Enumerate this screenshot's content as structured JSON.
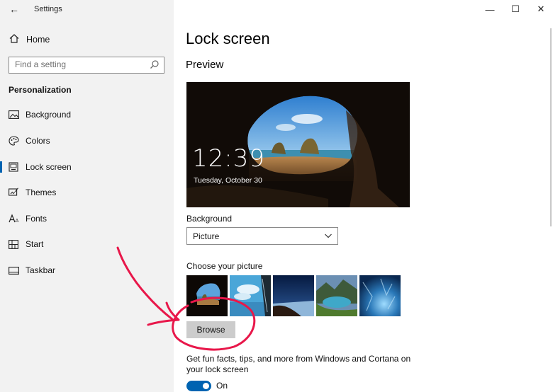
{
  "window": {
    "title": "Settings",
    "controls": {
      "minimize": "—",
      "maximize": "☐",
      "close": "✕"
    }
  },
  "sidebar": {
    "home_label": "Home",
    "search_placeholder": "Find a setting",
    "section_title": "Personalization",
    "items": [
      {
        "label": "Background",
        "icon": "picture-icon",
        "selected": false
      },
      {
        "label": "Colors",
        "icon": "palette-icon",
        "selected": false
      },
      {
        "label": "Lock screen",
        "icon": "lock-screen-icon",
        "selected": true
      },
      {
        "label": "Themes",
        "icon": "brush-icon",
        "selected": false
      },
      {
        "label": "Fonts",
        "icon": "font-icon",
        "selected": false
      },
      {
        "label": "Start",
        "icon": "start-icon",
        "selected": false
      },
      {
        "label": "Taskbar",
        "icon": "taskbar-icon",
        "selected": false
      }
    ]
  },
  "main": {
    "title": "Lock screen",
    "preview_heading": "Preview",
    "preview": {
      "time": "12:39",
      "date": "Tuesday, October 30"
    },
    "background_label": "Background",
    "background_value": "Picture",
    "choose_picture_label": "Choose your picture",
    "thumbnails": [
      "cave-beach",
      "sky-window",
      "night-sky-shore",
      "mountain-lake",
      "blue-ice"
    ],
    "browse_label": "Browse",
    "tips_label": "Get fun facts, tips, and more from Windows and Cortana on your lock screen",
    "tips_toggle_state": "On"
  },
  "colors": {
    "accent": "#0063b1",
    "sidebar_bg": "#f2f2f2",
    "annotation": "#e8174a"
  }
}
